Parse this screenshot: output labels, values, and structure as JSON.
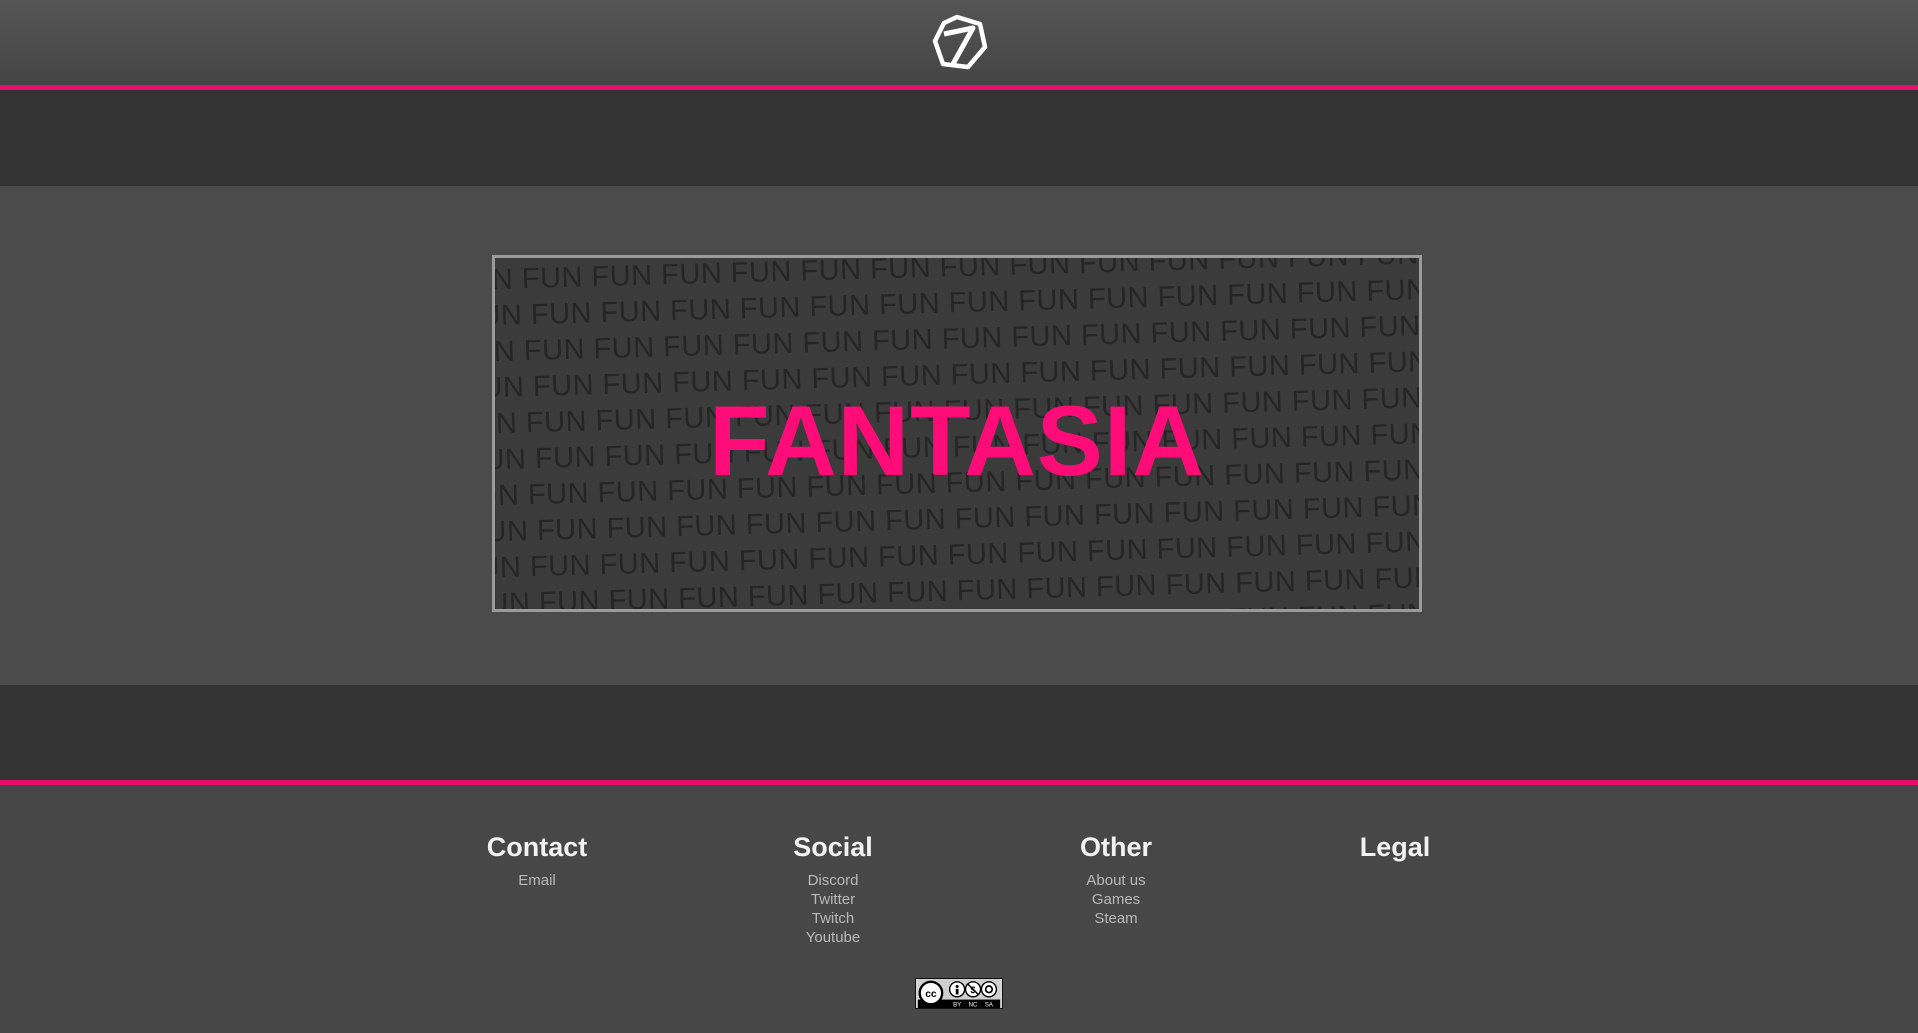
{
  "header": {
    "logo_icon": "hexagon-seven-logo-icon"
  },
  "banner": {
    "title": "FANTASIA",
    "pattern_word": "FUN",
    "title_color": "#ff0c79"
  },
  "footer": {
    "columns": [
      {
        "heading": "Contact",
        "links": [
          "Email"
        ]
      },
      {
        "heading": "Social",
        "links": [
          "Discord",
          "Twitter",
          "Twitch",
          "Youtube"
        ]
      },
      {
        "heading": "Other",
        "links": [
          "About us",
          "Games",
          "Steam"
        ]
      },
      {
        "heading": "Legal",
        "links": []
      }
    ],
    "license_badge": {
      "icon": "creative-commons-license-icon",
      "labels": [
        "BY",
        "NC",
        "SA"
      ]
    }
  },
  "colors": {
    "accent": "#e60f6e",
    "background": "#474747",
    "band": "#333333"
  }
}
